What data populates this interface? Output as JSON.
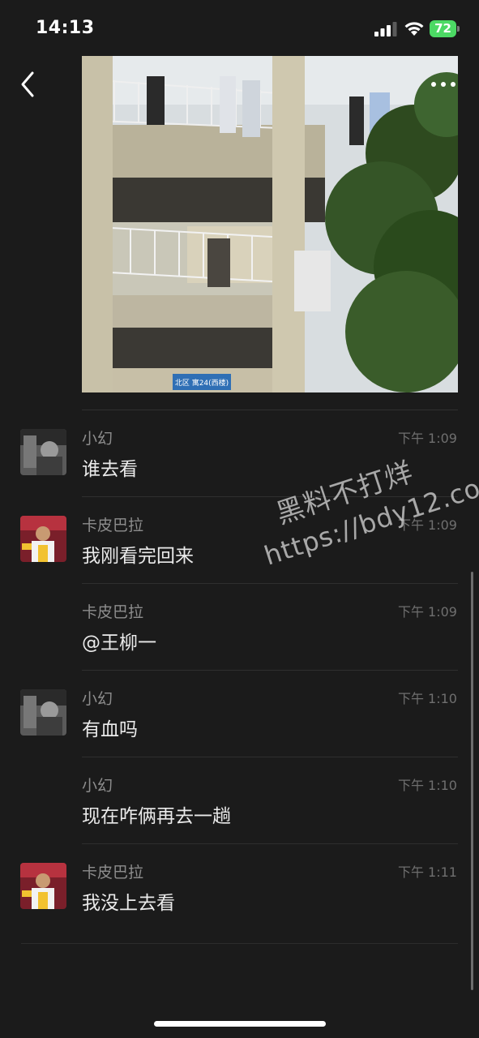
{
  "status_bar": {
    "time": "14:13",
    "battery_level": "72",
    "icons": [
      "signal-icon",
      "wifi-icon",
      "battery-icon"
    ]
  },
  "header": {
    "back_icon": "chevron-left-icon",
    "more_icon": "more-icon"
  },
  "photo": {
    "sign_text": "北区 寓24(西楼)"
  },
  "messages": [
    {
      "sender": "小幻",
      "time": "下午 1:09",
      "text": "谁去看",
      "avatar": "avatar-xiaohuan"
    },
    {
      "sender": "卡皮巴拉",
      "time": "下午 1:09",
      "text": "我刚看完回来",
      "avatar": "avatar-kapibala"
    },
    {
      "sender": "卡皮巴拉",
      "time": "下午 1:09",
      "text": "@王柳一",
      "avatar": ""
    },
    {
      "sender": "小幻",
      "time": "下午 1:10",
      "text": "有血吗",
      "avatar": "avatar-xiaohuan"
    },
    {
      "sender": "小幻",
      "time": "下午 1:10",
      "text": "现在咋俩再去一趟",
      "avatar": ""
    },
    {
      "sender": "卡皮巴拉",
      "time": "下午 1:11",
      "text": "我没上去看",
      "avatar": "avatar-kapibala"
    }
  ],
  "watermark": {
    "line1": "黑料不打烊",
    "line2": "https://bdy12.co"
  },
  "colors": {
    "background": "#1b1b1b",
    "battery": "#4cd964",
    "text_primary": "#eaeaea",
    "text_secondary": "#8d8d8d"
  }
}
